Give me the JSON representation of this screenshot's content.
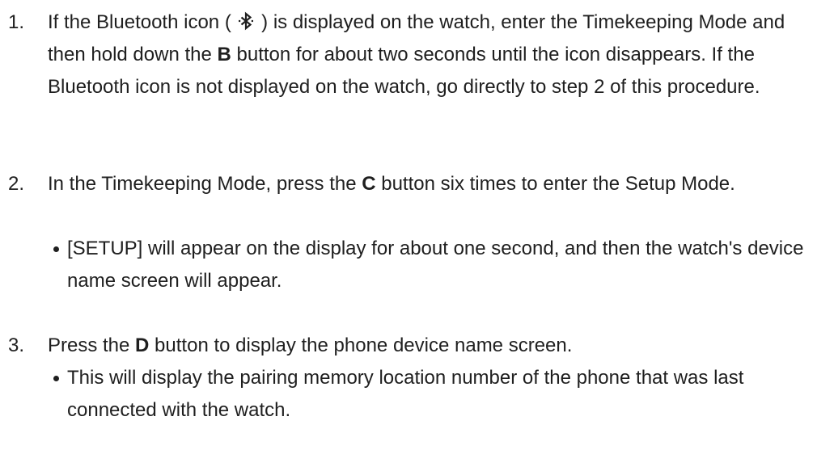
{
  "steps": [
    {
      "number": "1.",
      "text_a": "If the Bluetooth icon ( ",
      "icon": "bluetooth-icon",
      "text_b": " ) is displayed on the watch, enter the Timekeeping Mode and then hold down the ",
      "button": "B",
      "text_c": " button for about two seconds until the icon disappears. If the Bluetooth icon is not displayed on the watch, go directly to step 2 of this procedure."
    },
    {
      "number": "2.",
      "text_a": "In the Timekeeping Mode, press the ",
      "button": "C",
      "text_b": " button six times to enter the Setup Mode.",
      "bullet": "[SETUP] will appear on the display for about one second, and then the watch's device name screen will appear."
    },
    {
      "number": "3.",
      "text_a": "Press the ",
      "button": "D",
      "text_b": " button to display the phone device name screen.",
      "bullet": "This will display the pairing memory location number of the phone that was last connected with the watch."
    }
  ]
}
